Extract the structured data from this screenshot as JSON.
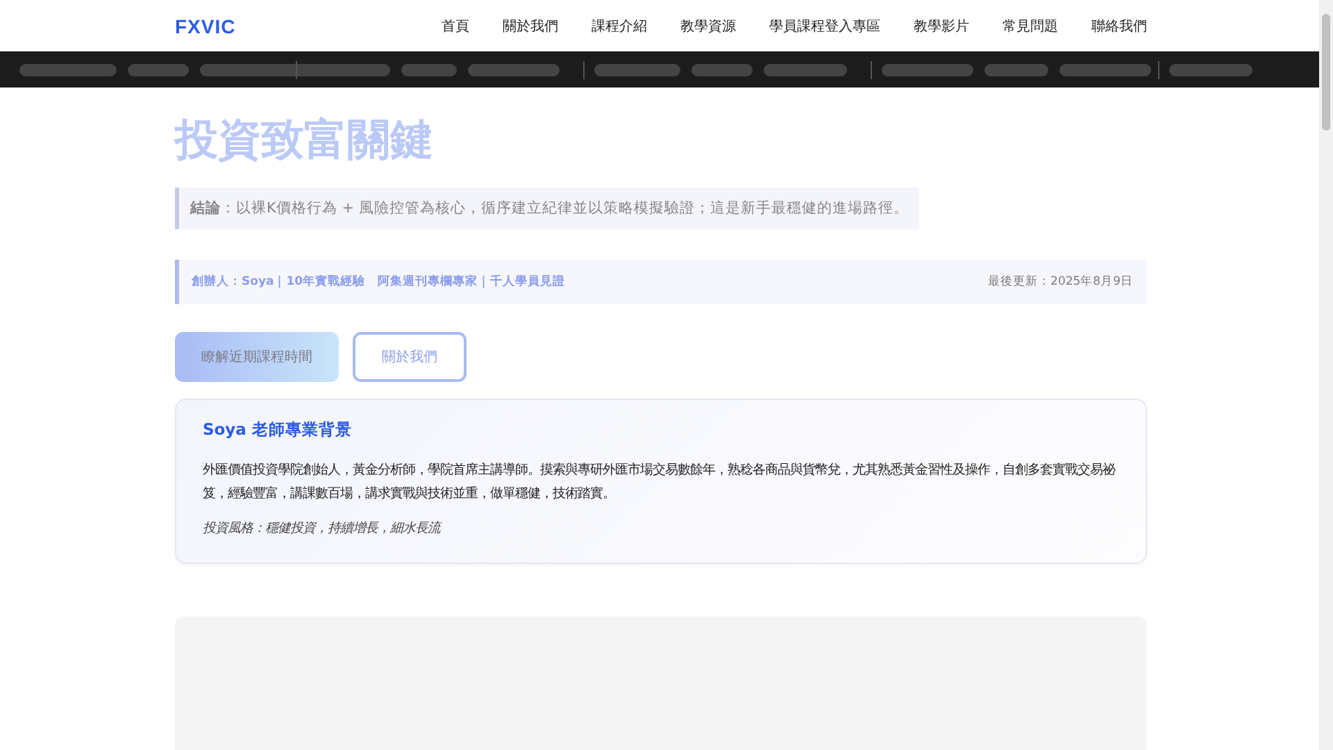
{
  "nav": {
    "logo": "FXVIC",
    "items": [
      "首頁",
      "關於我們",
      "課程介紹",
      "教學資源",
      "學員課程登入專區",
      "教學影片",
      "常見問題",
      "聯絡我們"
    ]
  },
  "hero": {
    "title_lines": [
      "投資致富關鍵"
    ],
    "conclusion": "**結論**：以裸K價格行為 + 風險控管為核心，循序建立紀律並以策略模擬驗證；這是新手最穩健的進場路徑。",
    "meta_left": "創辦人：Soya｜10年實戰經驗　阿集週刊專欄專家｜千人學員見證",
    "meta_right": "最後更新：2025年8月9日",
    "buttons": [
      {
        "label": "瞭解近期課程時間",
        "kind": "primary"
      },
      {
        "label": "關於我們",
        "kind": "outline"
      }
    ]
  },
  "profile": {
    "title": "Soya 老師專業背景",
    "text": "外匯價值投資學院創始人，黃金分析師，學院首席主講導師。摸索與專研外匯市場交易數餘年，熟稔各商品與貨幣兌，尤其熟悉黃金習性及操作，自創多套實戰交易祕笈，經驗豐富，講課數百場，講求實戰與技術並重，做單穩健，技術踏實。",
    "style": "投資風格：穩健投資，持續增長，細水長流"
  }
}
